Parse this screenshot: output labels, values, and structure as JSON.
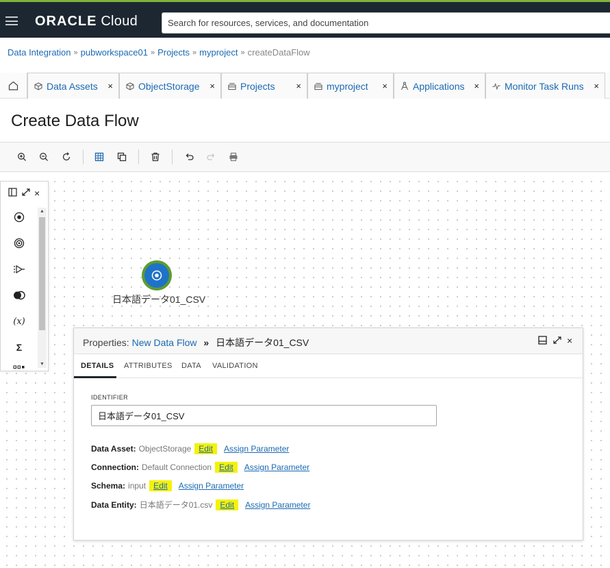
{
  "header": {
    "brand_bold": "ORACLE",
    "brand_light": "Cloud",
    "search_placeholder": "Search for resources, services, and documentation"
  },
  "breadcrumb": {
    "items": [
      "Data Integration",
      "pubworkspace01",
      "Projects",
      "myproject"
    ],
    "current": "createDataFlow",
    "separator": "»"
  },
  "tabs": [
    {
      "label": "Data Assets",
      "icon": "cube-icon"
    },
    {
      "label": "ObjectStorage",
      "icon": "cube-icon"
    },
    {
      "label": "Projects",
      "icon": "tray-icon"
    },
    {
      "label": "myproject",
      "icon": "tray-icon"
    },
    {
      "label": "Applications",
      "icon": "compass-icon"
    },
    {
      "label": "Monitor Task Runs",
      "icon": "pulse-icon"
    }
  ],
  "tab_close": "×",
  "page": {
    "title": "Create Data Flow"
  },
  "toolbar": {
    "icons": [
      "zoom-in-icon",
      "zoom-out-icon",
      "reset-icon",
      "grid-icon",
      "copy-icon",
      "delete-icon",
      "undo-icon",
      "redo-icon",
      "print-icon"
    ]
  },
  "palette": {
    "items": [
      "source-icon",
      "target-icon",
      "filter-icon",
      "join-icon",
      "expression-icon",
      "aggregate-icon"
    ],
    "expression_glyph": "(x)",
    "aggregate_glyph": "Σ"
  },
  "canvas": {
    "node_label": "日本語データ01_CSV"
  },
  "properties": {
    "prefix": "Properties:",
    "flow_name": "New Data Flow",
    "chevron": "»",
    "entity": "日本語データ01_CSV",
    "tabs": [
      "DETAILS",
      "ATTRIBUTES",
      "DATA",
      "VALIDATION"
    ],
    "active_tab": "DETAILS",
    "identifier_label": "IDENTIFIER",
    "identifier_value": "日本語データ01_CSV",
    "rows": [
      {
        "key": "Data Asset:",
        "value": "ObjectStorage",
        "edit": "Edit",
        "assign": "Assign Parameter"
      },
      {
        "key": "Connection:",
        "value": "Default Connection",
        "edit": "Edit",
        "assign": "Assign Parameter"
      },
      {
        "key": "Schema:",
        "value": "input",
        "edit": "Edit",
        "assign": "Assign Parameter"
      },
      {
        "key": "Data Entity:",
        "value": "日本語データ01.csv",
        "edit": "Edit",
        "assign": "Assign Parameter"
      }
    ]
  },
  "colors": {
    "topbar": "#1d2731",
    "accent_green": "#7fb23a",
    "link": "#1b6ab2",
    "highlight": "#f4f20a",
    "node_ring": "#5e9b2f",
    "node_fill": "#1e73c8"
  }
}
